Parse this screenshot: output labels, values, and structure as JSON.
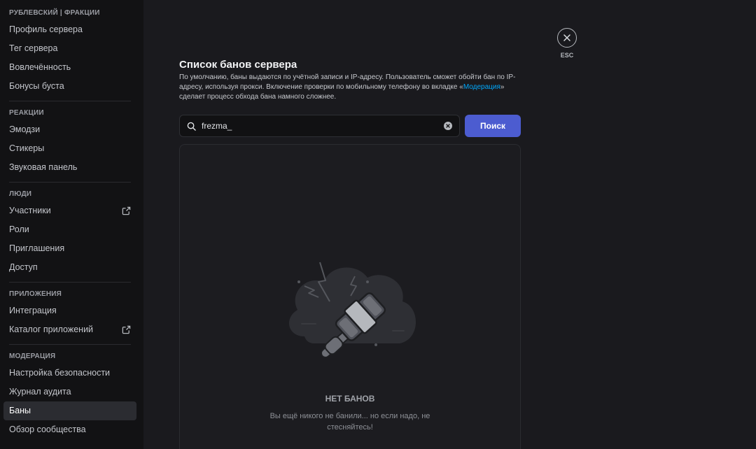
{
  "sidebar": {
    "sections": [
      {
        "header": "РУБЛЕВСКИЙ | ФРАКЦИИ",
        "items": [
          {
            "label": "Профиль сервера"
          },
          {
            "label": "Тег сервера"
          },
          {
            "label": "Вовлечённость"
          },
          {
            "label": "Бонусы буста"
          }
        ]
      },
      {
        "header": "РЕАКЦИИ",
        "items": [
          {
            "label": "Эмодзи"
          },
          {
            "label": "Стикеры"
          },
          {
            "label": "Звуковая панель"
          }
        ]
      },
      {
        "header": "ЛЮДИ",
        "items": [
          {
            "label": "Участники",
            "icon": "external-link-icon"
          },
          {
            "label": "Роли"
          },
          {
            "label": "Приглашения"
          },
          {
            "label": "Доступ"
          }
        ]
      },
      {
        "header": "ПРИЛОЖЕНИЯ",
        "items": [
          {
            "label": "Интеграция"
          },
          {
            "label": "Каталог приложений",
            "icon": "external-link-icon"
          }
        ]
      },
      {
        "header": "МОДЕРАЦИЯ",
        "items": [
          {
            "label": "Настройка безопасности"
          },
          {
            "label": "Журнал аудита"
          },
          {
            "label": "Баны",
            "active": true
          },
          {
            "label": "Обзор сообщества"
          }
        ]
      }
    ]
  },
  "close": {
    "label": "ESC",
    "icon": "close-icon"
  },
  "main": {
    "title": "Список банов сервера",
    "desc_part1": "По умолчанию, баны выдаются по учётной записи и IP-адресу. Пользователь сможет обойти бан по IP-адресу, используя прокси. Включение проверки по мобильному телефону во вкладке «",
    "desc_link": "Модерация",
    "desc_part2": "» сделает процесс обхода бана намного сложнее.",
    "search": {
      "value": "frezma_",
      "icon": "search-icon",
      "clear_icon": "clear-icon"
    },
    "search_button": "Поиск",
    "empty": {
      "title": "НЕТ БАНОВ",
      "text": "Вы ещё никого не банили... но если надо, не стесняйтесь!",
      "illustration": "ban-hammer-icon"
    }
  },
  "colors": {
    "accent": "#4c5cd0",
    "link": "#00a8fc",
    "sidebar_bg": "#121214",
    "main_bg": "#1a1a1e"
  }
}
